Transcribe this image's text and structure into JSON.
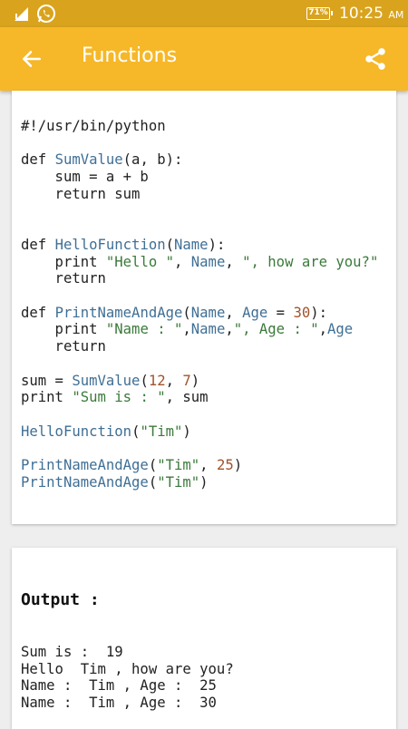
{
  "status_bar": {
    "battery": "71%",
    "time": "10:25",
    "ampm": "AM"
  },
  "app_bar": {
    "title": "Functions",
    "back_icon": "arrow-left-icon",
    "share_icon": "share-icon"
  },
  "code": {
    "lines": [
      "#!/usr/bin/python",
      "",
      "def SumValue(a, b):",
      "    sum = a + b",
      "    return sum",
      "",
      "",
      "def HelloFunction(Name):",
      "    print \"Hello \", Name, \", how are you?\"",
      "    return",
      "",
      "def PrintNameAndAge(Name, Age = 30):",
      "    print \"Name : \",Name,\", Age : \",Age",
      "    return",
      "",
      "sum = SumValue(12, 7)",
      "print \"Sum is : \", sum",
      "",
      "HelloFunction(\"Tim\")",
      "",
      "PrintNameAndAge(\"Tim\", 25)",
      "PrintNameAndAge(\"Tim\")"
    ]
  },
  "output": {
    "label": "Output :",
    "lines": [
      "Sum is :  19",
      "Hello  Tim , how are you?",
      "Name :  Tim , Age :  25",
      "Name :  Tim , Age :  30"
    ]
  },
  "colors": {
    "app_bar": "#f6b828",
    "status_bar": "#d9a31d",
    "function_name": "#3f6f95",
    "string": "#3b7a3b",
    "number": "#a0522d"
  }
}
